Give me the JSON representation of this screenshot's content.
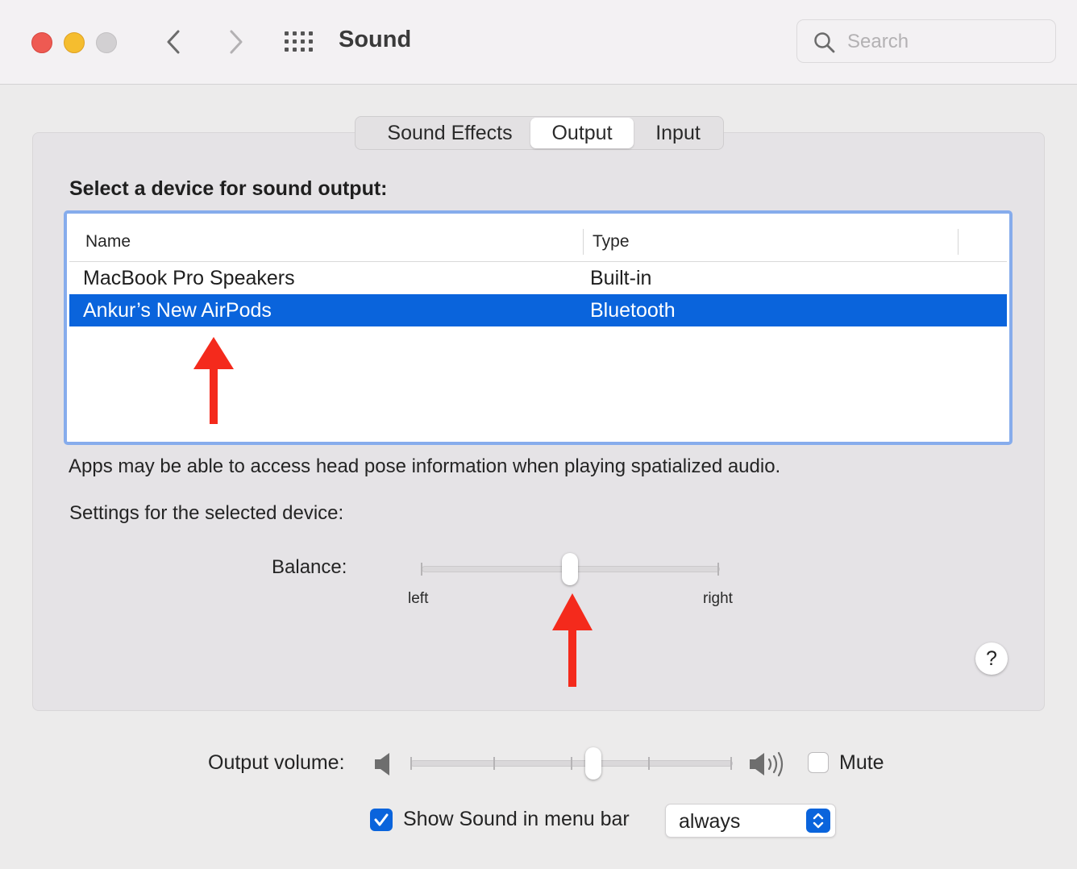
{
  "window": {
    "title": "Sound",
    "search_placeholder": "Search"
  },
  "tabs": [
    {
      "label": "Sound Effects",
      "selected": false
    },
    {
      "label": "Output",
      "selected": true
    },
    {
      "label": "Input",
      "selected": false
    }
  ],
  "output": {
    "heading": "Select a device for sound output:",
    "columns": [
      "Name",
      "Type"
    ],
    "devices": [
      {
        "name": "MacBook Pro Speakers",
        "type": "Built-in",
        "selected": false
      },
      {
        "name": "Ankur’s New AirPods",
        "type": "Bluetooth",
        "selected": true
      }
    ],
    "info": "Apps may be able to access head pose information when playing spatialized audio.",
    "settings_label": "Settings for the selected device:",
    "balance": {
      "label": "Balance:",
      "left_label": "left",
      "right_label": "right",
      "value": 0.5
    },
    "help": "?"
  },
  "footer": {
    "volume_label": "Output volume:",
    "volume_value": 0.56,
    "mute_label": "Mute",
    "mute_checked": false,
    "menubar_label": "Show Sound in menu bar",
    "menubar_checked": true,
    "menubar_option": "always"
  },
  "colors": {
    "accent": "#0a64dc",
    "annotation_arrow": "#f42a1c",
    "table_focus_ring": "#86acec"
  }
}
